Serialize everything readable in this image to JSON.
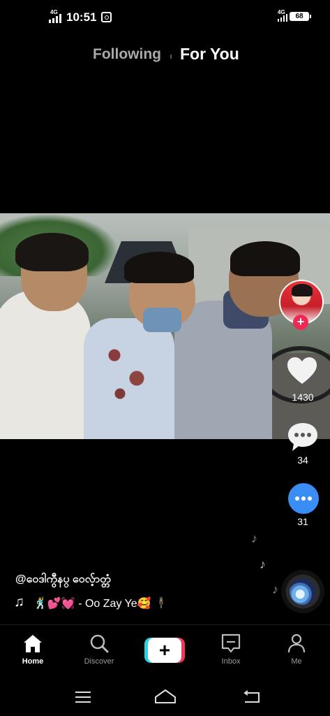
{
  "status_bar": {
    "network": "4G",
    "time": "10:51",
    "network_right": "4G",
    "battery": "68"
  },
  "top_tabs": {
    "following": "Following",
    "for_you": "For You"
  },
  "video": {
    "description_icon": "video-frame"
  },
  "right_rail": {
    "follow_label": "+",
    "likes": "1430",
    "comments": "34",
    "shares": "31"
  },
  "caption": {
    "username": "@ဝေဒါကွီနပ္ ဝေလ့်ာတ္တံ",
    "music_note": "♫",
    "song": "🕺💕💓 - Oo Zay Ye🥰 🕴"
  },
  "bottom_nav": {
    "home": "Home",
    "discover": "Discover",
    "create": "+",
    "inbox": "Inbox",
    "me": "Me"
  },
  "colors": {
    "accent_red": "#ee2a54",
    "accent_cyan": "#26d4e6",
    "share_blue": "#3b8df6",
    "background": "#000000"
  }
}
